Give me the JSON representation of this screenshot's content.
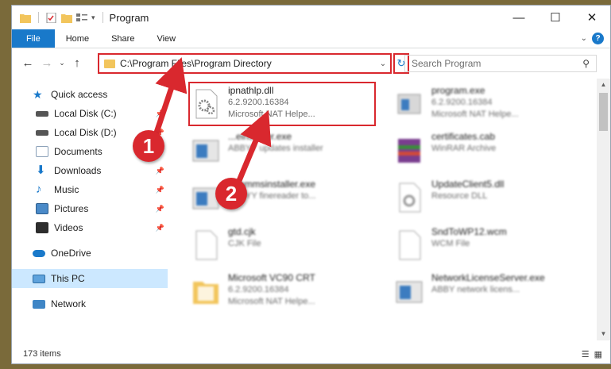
{
  "window": {
    "title": "Program",
    "controls": {
      "minimize": "—",
      "maximize": "☐",
      "close": "✕"
    }
  },
  "ribbon": {
    "tabs": [
      "File",
      "Home",
      "Share",
      "View"
    ]
  },
  "address": {
    "path": "C:\\Program Files\\Program Directory"
  },
  "search": {
    "placeholder": "Search Program"
  },
  "nav": {
    "items": [
      {
        "label": "Quick access",
        "icon": "star-icon",
        "pinned": false
      },
      {
        "label": "Local Disk (C:)",
        "icon": "drive-icon",
        "pinned": true
      },
      {
        "label": "Local Disk (D:)",
        "icon": "drive-icon",
        "pinned": true
      },
      {
        "label": "Documents",
        "icon": "documents-icon",
        "pinned": true
      },
      {
        "label": "Downloads",
        "icon": "downloads-icon",
        "pinned": true
      },
      {
        "label": "Music",
        "icon": "music-icon",
        "pinned": true
      },
      {
        "label": "Pictures",
        "icon": "pictures-icon",
        "pinned": true
      },
      {
        "label": "Videos",
        "icon": "videos-icon",
        "pinned": true
      },
      {
        "label": "OneDrive",
        "icon": "cloud-icon",
        "pinned": false
      },
      {
        "label": "This PC",
        "icon": "computer-icon",
        "pinned": false
      },
      {
        "label": "Network",
        "icon": "network-icon",
        "pinned": false
      }
    ]
  },
  "files": [
    {
      "name": "ipnathlp.dll",
      "line1": "6.2.9200.16384",
      "line2": "Microsoft NAT Helpe...",
      "icon": "dll-gear-icon"
    },
    {
      "name": "program.exe",
      "line1": "6.2.9200.16384",
      "line2": "Microsoft NAT Helpe...",
      "icon": "exe-icon"
    },
    {
      "name": "...einstaller.exe",
      "line1": "ABBYY updates installer",
      "line2": "",
      "icon": "installer-icon"
    },
    {
      "name": "certificates.cab",
      "line1": "WinRAR Archive",
      "line2": "",
      "icon": "winrar-icon"
    },
    {
      "name": "...rammsinstaller.exe",
      "line1": "ABBYY finereader to...",
      "line2": "",
      "icon": "installer-icon"
    },
    {
      "name": "UpdateClient5.dll",
      "line1": "Resource DLL",
      "line2": "",
      "icon": "dll-icon"
    },
    {
      "name": "gtd.cjk",
      "line1": "CJK File",
      "line2": "",
      "icon": "file-icon"
    },
    {
      "name": "SndToWP12.wcm",
      "line1": "WCM File",
      "line2": "",
      "icon": "file-icon"
    },
    {
      "name": "Microsoft VC90 CRT",
      "line1": "6.2.9200.16384",
      "line2": "Microsoft NAT Helpe...",
      "icon": "folder-icon"
    },
    {
      "name": "NetworkLicenseServer.exe",
      "line1": "ABBY network licens...",
      "line2": "",
      "icon": "installer-icon"
    }
  ],
  "status": {
    "count": "173 items"
  },
  "callouts": [
    "1",
    "2"
  ],
  "colors": {
    "accent": "#1979ca",
    "highlight": "#d9282e",
    "selected": "#cce8ff"
  }
}
